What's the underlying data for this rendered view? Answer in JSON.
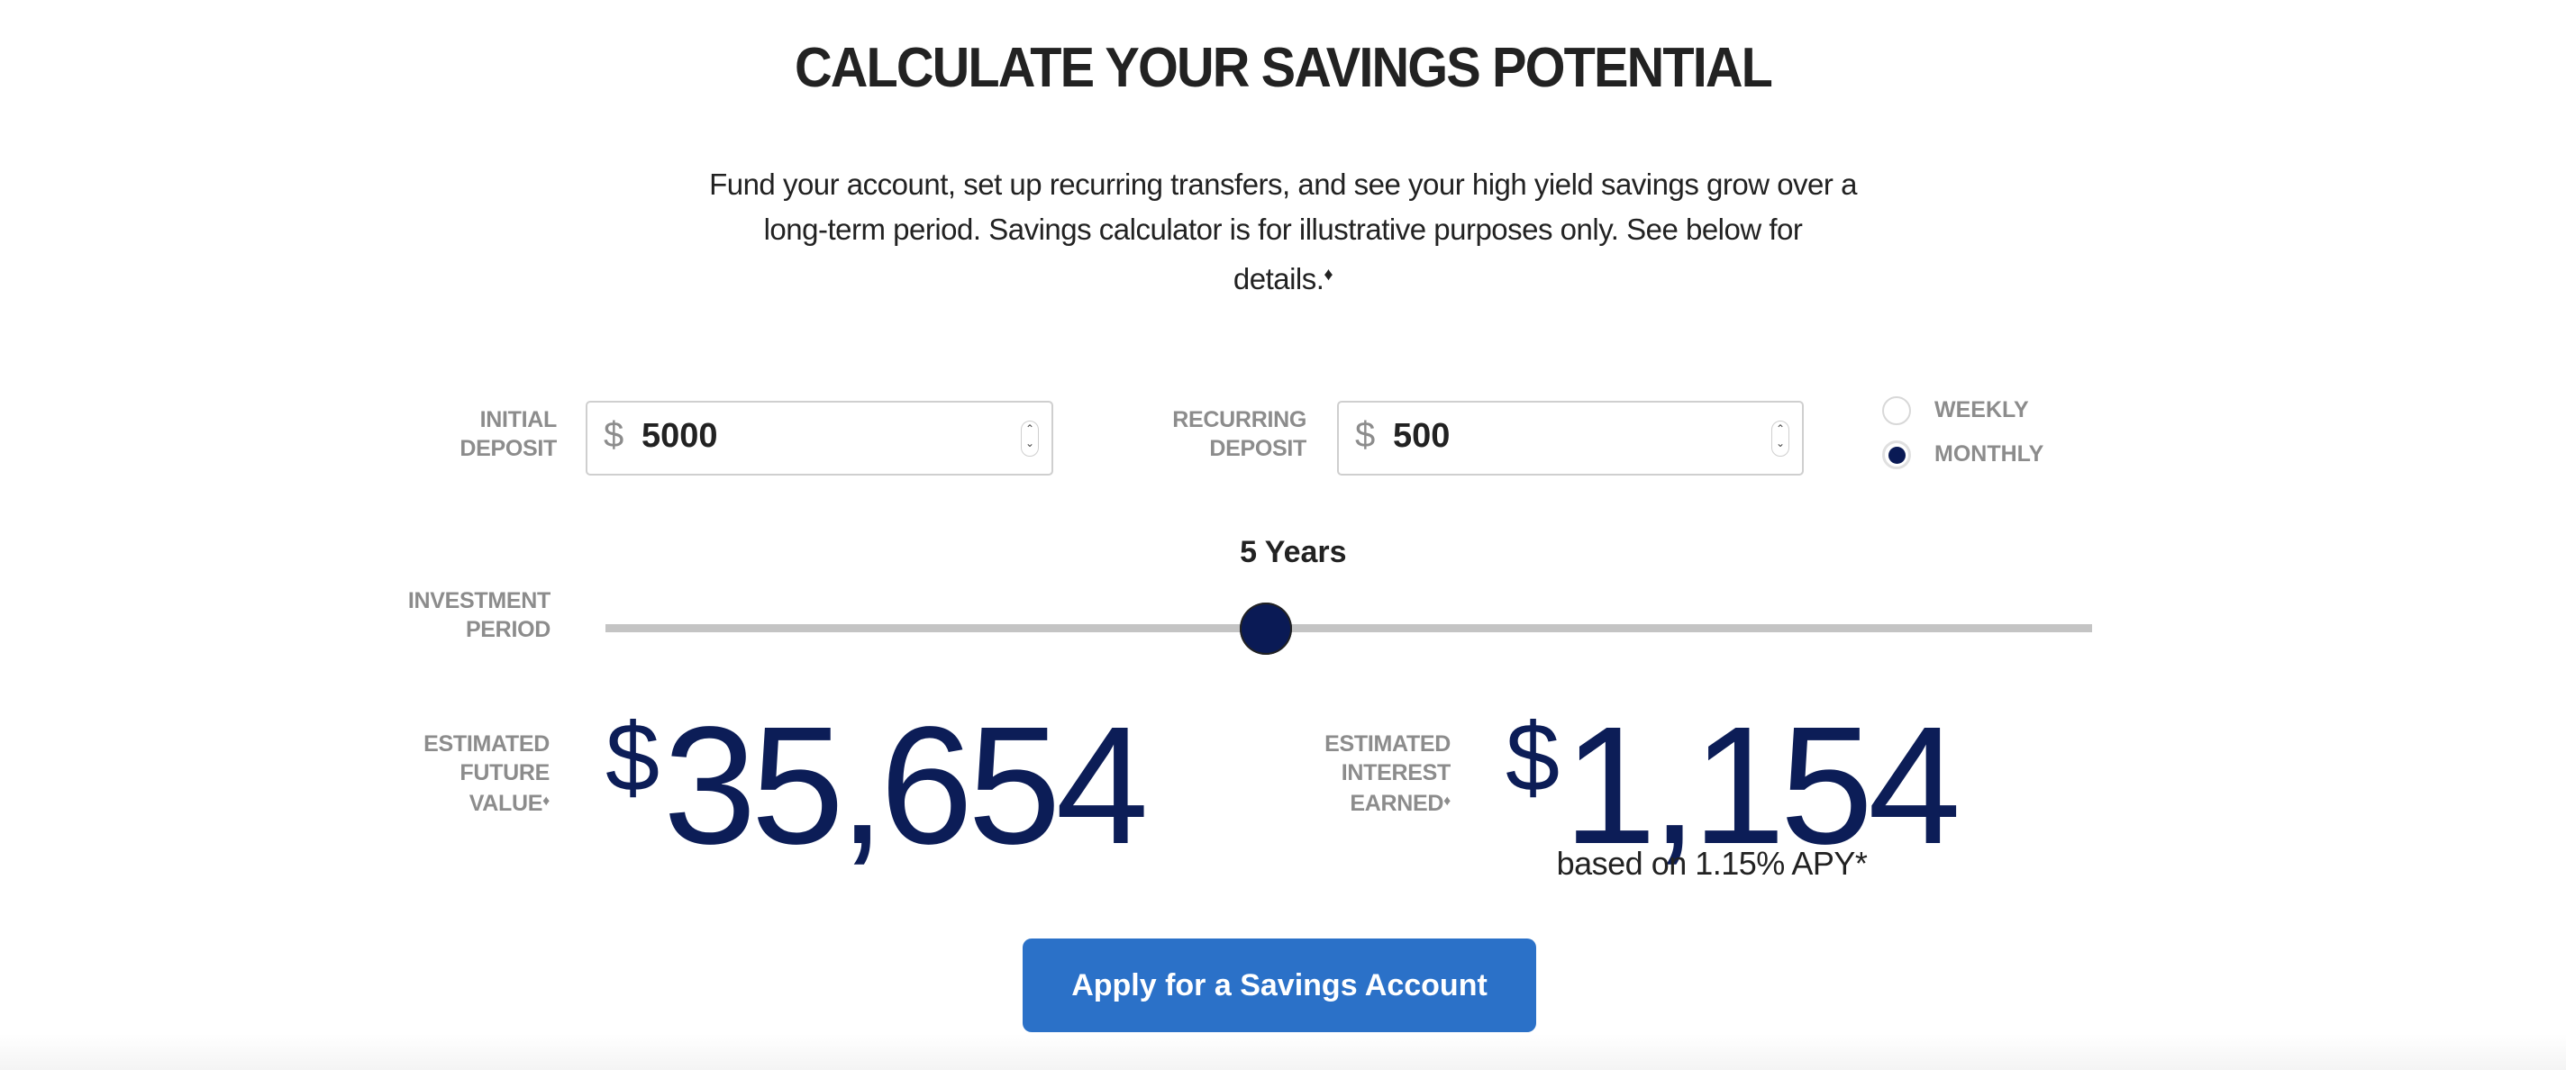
{
  "header": {
    "title": "CALCULATE YOUR SAVINGS POTENTIAL",
    "intro_line1": "Fund your account, set up recurring transfers, and see your high yield savings grow over a",
    "intro_line2": "long-term period. Savings calculator is for illustrative purposes only. See below for",
    "intro_line3": "details.",
    "footnote_symbol": "♦"
  },
  "inputs": {
    "initial_deposit": {
      "label_line1": "INITIAL",
      "label_line2": "DEPOSIT",
      "currency_symbol": "$",
      "value": "5000"
    },
    "recurring_deposit": {
      "label_line1": "RECURRING",
      "label_line2": "DEPOSIT",
      "currency_symbol": "$",
      "value": "500"
    },
    "frequency": {
      "options": [
        {
          "label": "WEEKLY",
          "selected": false
        },
        {
          "label": "MONTHLY",
          "selected": true
        }
      ]
    }
  },
  "investment_period": {
    "label_line1": "INVESTMENT",
    "label_line2": "PERIOD",
    "value_label": "5 Years",
    "value_years": 5,
    "min_years": 1,
    "max_years": 10
  },
  "results": {
    "future_value": {
      "label_line1": "ESTIMATED",
      "label_line2": "FUTURE",
      "label_line3": "VALUE",
      "currency_symbol": "$",
      "amount": "35,654"
    },
    "interest_earned": {
      "label_line1": "ESTIMATED",
      "label_line2": "INTEREST",
      "label_line3": "EARNED",
      "currency_symbol": "$",
      "amount": "1,154",
      "note": "based on 1.15% APY*"
    }
  },
  "cta": {
    "label": "Apply for a Savings Account"
  },
  "colors": {
    "accent_navy": "#0c1d57",
    "button_blue": "#2b71c8",
    "label_gray": "#8c8c8c",
    "track_gray": "#c4c4c4"
  }
}
